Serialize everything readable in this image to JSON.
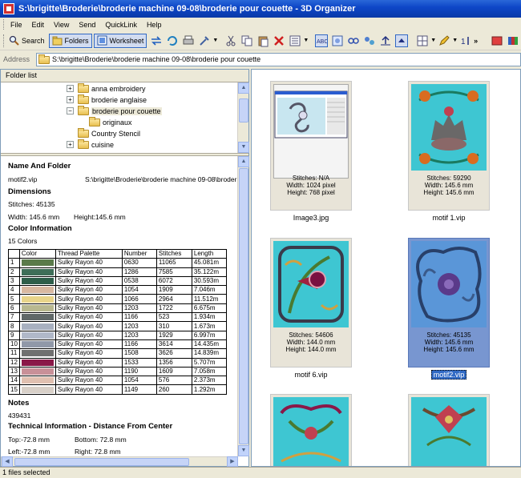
{
  "window": {
    "title": "S:\\brigitte\\Broderie\\broderie machine 09-08\\broderie pour couette - 3D Organizer"
  },
  "menu": [
    "File",
    "Edit",
    "View",
    "Send",
    "QuickLink",
    "Help"
  ],
  "toolbar": {
    "search_label": "Search",
    "folders_label": "Folders",
    "worksheet_label": "Worksheet"
  },
  "address": {
    "label": "Address",
    "value": "S:\\brigitte\\Broderie\\broderie machine 09-08\\broderie pour couette"
  },
  "folder_list": {
    "header": "Folder list",
    "items": [
      {
        "label": "anna embroidery"
      },
      {
        "label": "broderie anglaise"
      },
      {
        "label": "broderie pour couette"
      },
      {
        "label": "originaux"
      },
      {
        "label": "Country Stencil"
      },
      {
        "label": "cuisine"
      }
    ]
  },
  "info": {
    "name_heading": "Name And Folder",
    "file_name": "motif2.vip",
    "folder_path": "S:\\brigitte\\Broderie\\broderie machine 09-08\\broder",
    "dimensions_heading": "Dimensions",
    "stitches": "Stitches: 45135",
    "width": "Width: 145.6 mm",
    "height": "Height:145.6 mm",
    "color_heading": "Color Information",
    "color_count": "15 Colors",
    "columns": [
      "",
      "Color",
      "Thread Palette",
      "Number",
      "Stitches",
      "Length"
    ],
    "rows": [
      {
        "idx": "1",
        "color": "#5a7a4a",
        "palette": "Sulky Rayon 40",
        "number": "0630",
        "stitches": "11065",
        "length": "45.081m"
      },
      {
        "idx": "2",
        "color": "#3e6e58",
        "palette": "Sulky Rayon 40",
        "number": "1286",
        "stitches": "7585",
        "length": "35.122m"
      },
      {
        "idx": "3",
        "color": "#2e5e4a",
        "palette": "Sulky Rayon 40",
        "number": "0538",
        "stitches": "6072",
        "length": "30.593m"
      },
      {
        "idx": "4",
        "color": "#d8b8a0",
        "palette": "Sulky Rayon 40",
        "number": "1054",
        "stitches": "1909",
        "length": "7.046m"
      },
      {
        "idx": "5",
        "color": "#e8d48a",
        "palette": "Sulky Rayon 40",
        "number": "1066",
        "stitches": "2964",
        "length": "11.512m"
      },
      {
        "idx": "6",
        "color": "#b8b890",
        "palette": "Sulky Rayon 40",
        "number": "1203",
        "stitches": "1722",
        "length": "6.675m"
      },
      {
        "idx": "7",
        "color": "#606868",
        "palette": "Sulky Rayon 40",
        "number": "1166",
        "stitches": "523",
        "length": "1.934m"
      },
      {
        "idx": "8",
        "color": "#a8b0c0",
        "palette": "Sulky Rayon 40",
        "number": "1203",
        "stitches": "310",
        "length": "1.673m"
      },
      {
        "idx": "9",
        "color": "#b0b8c8",
        "palette": "Sulky Rayon 40",
        "number": "1203",
        "stitches": "1929",
        "length": "6.997m"
      },
      {
        "idx": "10",
        "color": "#9098a8",
        "palette": "Sulky Rayon 40",
        "number": "1166",
        "stitches": "3614",
        "length": "14.435m"
      },
      {
        "idx": "11",
        "color": "#707070",
        "palette": "Sulky Rayon 40",
        "number": "1508",
        "stitches": "3626",
        "length": "14.839m"
      },
      {
        "idx": "12",
        "color": "#8a1848",
        "palette": "Sulky Rayon 40",
        "number": "1533",
        "stitches": "1356",
        "length": "5.707m"
      },
      {
        "idx": "13",
        "color": "#c89098",
        "palette": "Sulky Rayon 40",
        "number": "1190",
        "stitches": "1609",
        "length": "7.058m"
      },
      {
        "idx": "14",
        "color": "#e0c0b0",
        "palette": "Sulky Rayon 40",
        "number": "1054",
        "stitches": "576",
        "length": "2.373m"
      },
      {
        "idx": "15",
        "color": "#d8d0c8",
        "palette": "Sulky Rayon 40",
        "number": "1149",
        "stitches": "260",
        "length": "1.292m"
      }
    ],
    "notes_heading": "Notes",
    "notes_value": "439431",
    "tech_heading": "Technical Information - Distance From Center",
    "top": "Top:-72.8 mm",
    "bottom": "Bottom: 72.8 mm",
    "left": "Left:-72.8 mm",
    "right": "Right: 72.8 mm"
  },
  "thumbnails": [
    {
      "name": "Image3.jpg",
      "stitches": "Stitches: N/A",
      "width": "Width: 1024 pixel",
      "height": "Height: 768 pixel"
    },
    {
      "name": "motif 1.vip",
      "stitches": "Stitches: 59290",
      "width": "Width: 145.6 mm",
      "height": "Height: 145.6 mm"
    },
    {
      "name": "motif 6.vip",
      "stitches": "Stitches: 54606",
      "width": "Width: 144.0 mm",
      "height": "Height: 144.0 mm"
    },
    {
      "name": "motif2.vip",
      "stitches": "Stitches: 45135",
      "width": "Width: 145.6 mm",
      "height": "Height: 145.6 mm"
    },
    {
      "name": "",
      "stitches": "",
      "width": "",
      "height": ""
    },
    {
      "name": "",
      "stitches": "",
      "width": "",
      "height": ""
    }
  ],
  "status": {
    "text": "1 files selected"
  }
}
